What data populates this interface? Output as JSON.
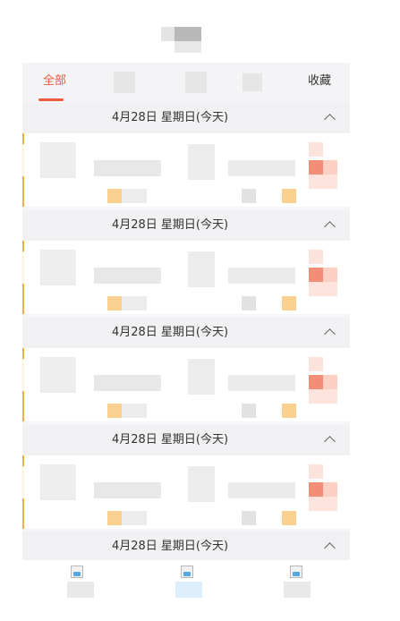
{
  "tabs": [
    {
      "label": "全部",
      "active": true
    },
    {
      "label": "",
      "active": false
    },
    {
      "label": "",
      "active": false
    },
    {
      "label": "",
      "active": false
    },
    {
      "label": "收藏",
      "active": false
    }
  ],
  "sections": [
    {
      "date": "4月28日 星期日(今天)"
    },
    {
      "date": "4月28日 星期日(今天)"
    },
    {
      "date": "4月28日 星期日(今天)"
    },
    {
      "date": "4月28日 星期日(今天)"
    },
    {
      "date": "4月28日 星期日(今天)"
    }
  ],
  "colors": {
    "accent": "#ee5a3a",
    "card_accent": "#f0b040",
    "highlight": "#f38e76"
  },
  "icons": {
    "section_toggle": "chevron-up-icon",
    "bottom_tab": "broken-image-icon"
  }
}
